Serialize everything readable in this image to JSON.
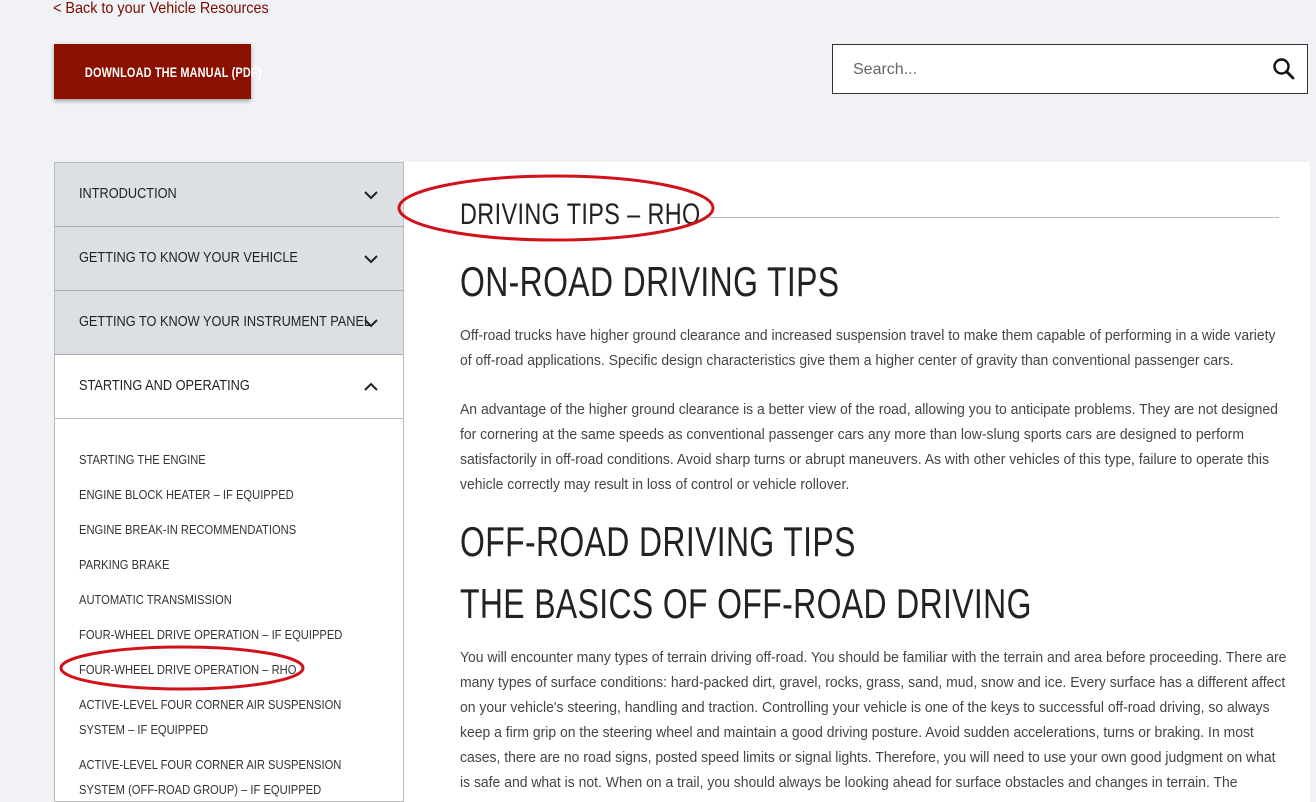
{
  "nav": {
    "back_link": "< Back to your Vehicle Resources",
    "download_button": "DOWNLOAD THE MANUAL (PDF)"
  },
  "search": {
    "placeholder": "Search..."
  },
  "sidebar": {
    "sections": [
      {
        "label": "INTRODUCTION",
        "open": false
      },
      {
        "label": "GETTING TO KNOW YOUR VEHICLE",
        "open": false
      },
      {
        "label": "GETTING TO KNOW YOUR INSTRUMENT PANEL",
        "open": false
      },
      {
        "label": "STARTING AND OPERATING",
        "open": true
      }
    ],
    "sub_items": [
      "STARTING THE ENGINE",
      "ENGINE BLOCK HEATER – IF EQUIPPED",
      "ENGINE BREAK-IN RECOMMENDATIONS",
      "PARKING BRAKE",
      "AUTOMATIC TRANSMISSION",
      "FOUR-WHEEL DRIVE OPERATION – IF EQUIPPED",
      "FOUR-WHEEL DRIVE OPERATION – RHO",
      "ACTIVE-LEVEL FOUR CORNER AIR SUSPENSION SYSTEM – IF EQUIPPED",
      "ACTIVE-LEVEL FOUR CORNER AIR SUSPENSION SYSTEM (OFF-ROAD GROUP) – IF EQUIPPED"
    ]
  },
  "main": {
    "section_title": "DRIVING TIPS – RHO",
    "heading_onroad": "ON-ROAD DRIVING TIPS",
    "para1": "Off-road trucks have higher ground clearance and increased suspension travel to make them capable of performing in a wide variety of off-road applications. Specific design characteristics give them a higher center of gravity than conventional passenger cars.",
    "para2": "An advantage of the higher ground clearance is a better view of the road, allowing you to anticipate problems. They are not designed for cornering at the same speeds as conventional passenger cars any more than low-slung sports cars are designed to perform satisfactorily in off-road conditions. Avoid sharp turns or abrupt maneuvers. As with other vehicles of this type, failure to operate this vehicle correctly may result in loss of control or vehicle rollover.",
    "heading_offroad": "OFF-ROAD DRIVING TIPS",
    "heading_basics": "THE BASICS OF OFF-ROAD DRIVING",
    "para3": "You will encounter many types of terrain driving off-road. You should be familiar with the terrain and area before proceeding. There are many types of surface conditions: hard-packed dirt, gravel, rocks, grass, sand, mud, snow and ice. Every surface has a different affect on your vehicle's steering, handling and traction. Controlling your vehicle is one of the keys to successful off-road driving, so always keep a firm grip on the steering wheel and maintain a good driving posture. Avoid sudden accelerations, turns or braking. In most cases, there are no road signs, posted speed limits or signal lights. Therefore, you will need to use your own good judgment on what is safe and what is not. When on a trail, you should always be looking ahead for surface obstacles and changes in terrain. The"
  },
  "colors": {
    "accent": "#8a1000",
    "annotation": "#d0121b",
    "sidebar_bg": "#dcdfe4",
    "page_bg": "#f1f2f5"
  }
}
